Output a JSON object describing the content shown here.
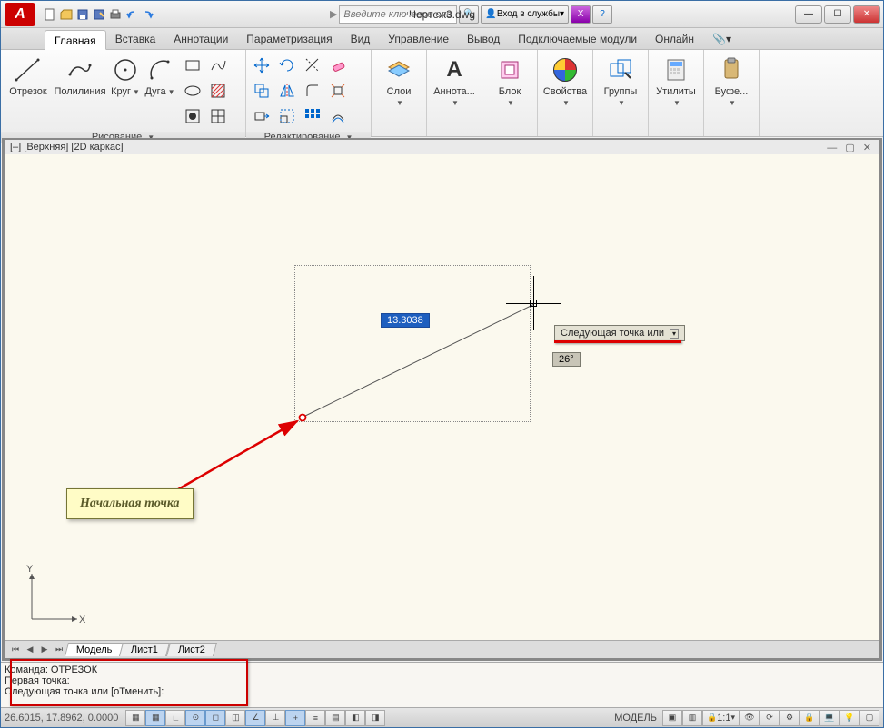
{
  "title": "Чертеж3.dwg",
  "search_placeholder": "Введите ключевое слово/фразу",
  "login_label": "Вход в службы",
  "tabs": [
    "Главная",
    "Вставка",
    "Аннотации",
    "Параметризация",
    "Вид",
    "Управление",
    "Вывод",
    "Подключаемые модули",
    "Онлайн"
  ],
  "active_tab": 0,
  "panels": {
    "draw": {
      "title": "Рисование",
      "items": [
        "Отрезок",
        "Полилиния",
        "Круг",
        "Дуга"
      ]
    },
    "edit": {
      "title": "Редактирование"
    },
    "layers": "Слои",
    "annot": "Аннота...",
    "block": "Блок",
    "props": "Свойства",
    "groups": "Группы",
    "utils": "Утилиты",
    "clip": "Буфе..."
  },
  "viewport_label": "[–] [Верхняя] [2D каркас]",
  "dim_value": "13.3038",
  "angle_value": "26°",
  "tooltip": "Следующая точка или",
  "callout": "Начальная точка",
  "sheet_tabs": [
    "Модель",
    "Лист1",
    "Лист2"
  ],
  "cmd": {
    "line1": "Команда: ОТРЕЗОК",
    "line2": "Первая точка:",
    "line3": "Следующая точка или [оТменить]:"
  },
  "status": {
    "coords": "26.6015, 17.8962, 0.0000",
    "model": "МОДЕЛЬ",
    "scale": "1:1"
  }
}
